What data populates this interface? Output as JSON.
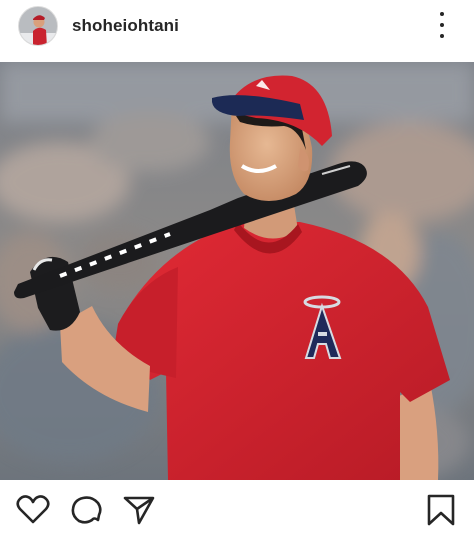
{
  "post": {
    "username": "shoheiohtani",
    "photo_logo_letter": "A"
  },
  "icons": {
    "more": "more-vertical-icon",
    "like": "heart-icon",
    "comment": "comment-icon",
    "share": "send-icon",
    "save": "bookmark-icon"
  },
  "colors": {
    "jersey_red": "#d0222e",
    "text": "#262626"
  }
}
